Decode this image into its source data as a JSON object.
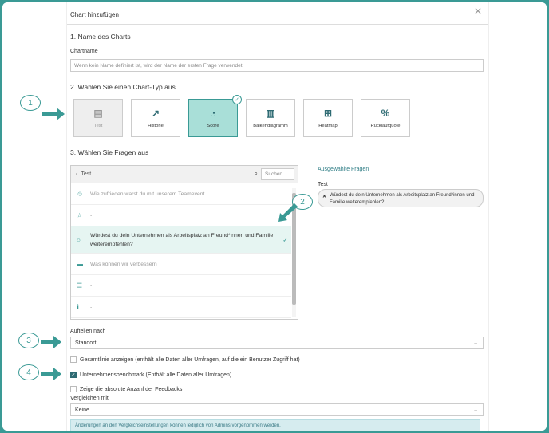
{
  "dialog": {
    "title": "Chart hinzufügen",
    "close_icon": "close-icon"
  },
  "name_section": {
    "heading": "1. Name des Charts",
    "label": "Chartname",
    "placeholder": "Wenn kein Name definiert ist, wird der Name der ersten Frage verwendet."
  },
  "type_section": {
    "heading": "2. Wählen Sie einen Chart-Typ aus",
    "types": [
      {
        "label": "Test",
        "icon": "table-icon",
        "state": "disabled"
      },
      {
        "label": "Historie",
        "icon": "trend-chart-icon",
        "state": "normal"
      },
      {
        "label": "Score",
        "icon": "gauge-icon",
        "state": "selected"
      },
      {
        "label": "Balkendiagramm",
        "icon": "bar-chart-icon",
        "state": "normal"
      },
      {
        "label": "Heatmap",
        "icon": "grid-icon",
        "state": "normal"
      },
      {
        "label": "Rücklaufquote",
        "icon": "percent-icon",
        "state": "normal"
      }
    ]
  },
  "questions_section": {
    "heading": "3. Wählen Sie Fragen aus",
    "panel_title": "Test",
    "search_placeholder": "Suchen",
    "rows": [
      {
        "icon": "smiley-icon",
        "text": "Wie zufrieden warst du mit unserem Teamevent"
      },
      {
        "icon": "star-icon",
        "text": "-"
      },
      {
        "icon": "circle-icon",
        "text": "Würdest du dein Unternehmen als Arbeitsplatz an Freund*innen und Familie weiterempfehlen?",
        "selected": true
      },
      {
        "icon": "text-line-icon",
        "text": "Was können wir verbessern"
      },
      {
        "icon": "list-icon",
        "text": "-"
      },
      {
        "icon": "info-icon",
        "text": "-"
      }
    ],
    "selected_heading": "Ausgewählte Fragen",
    "selected_group": "Test",
    "selected_chip": "Würdest du dein Unternehmen als Arbeitsplatz an Freund*innen und Familie weiterempfehlen?"
  },
  "split": {
    "label": "Aufteilen nach",
    "value": "Standort"
  },
  "checkboxes": [
    {
      "label": "Gesamtlinie anzeigen (enthält alle Daten aller Umfragen, auf die ein Benutzer Zugriff hat)",
      "checked": false
    },
    {
      "label": "Unternehmensbenchmark (Enthält alle Daten aller Umfragen)",
      "checked": true
    },
    {
      "label": "Zeige die absolute Anzahl der Feedbacks",
      "checked": false
    }
  ],
  "compare": {
    "label": "Vergleichen mit",
    "value": "Keine"
  },
  "info_text": "Änderungen an den Vergleichseinstellungen können lediglich von Admins vorgenommen werden.",
  "markers": [
    "1",
    "2",
    "3",
    "4"
  ],
  "colors": {
    "accent": "#3a9a95",
    "selected_bg": "#a9dfd8",
    "info_bg": "#d6ecef"
  }
}
